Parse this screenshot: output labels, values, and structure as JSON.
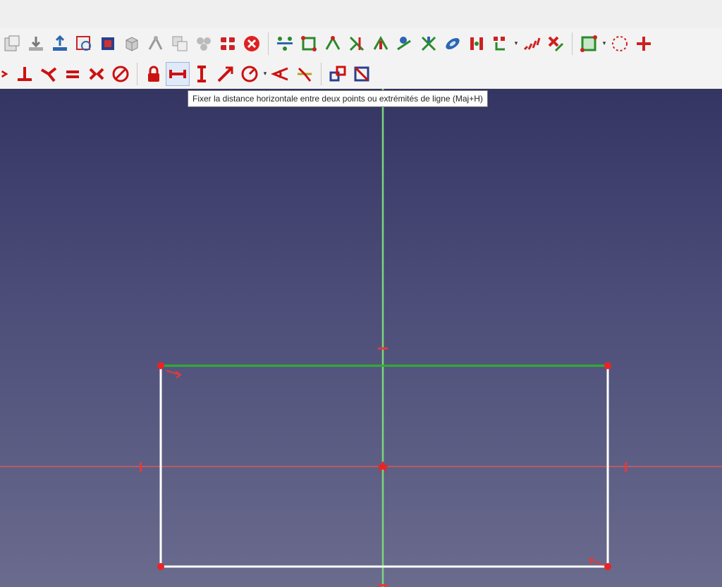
{
  "tooltip": {
    "text": "Fixer la distance horizontale entre deux points ou extrémités de ligne (Maj+H)"
  },
  "toolbar_row1": [
    {
      "name": "part-icon",
      "color": "#8a8a8a"
    },
    {
      "name": "download-icon",
      "color": "#7a7a7a"
    },
    {
      "name": "upload-icon",
      "color": "#2c66b0"
    },
    {
      "name": "view-section-icon",
      "color": "#cc2222"
    },
    {
      "name": "sketch-view-icon",
      "color": "#2a3f8c"
    },
    {
      "name": "cube-icon",
      "color": "#9a9a9a"
    },
    {
      "name": "constraint-tools-icon",
      "color": "#9a9a9a"
    },
    {
      "name": "merge-sketch-icon",
      "color": "#9a9a9a"
    },
    {
      "name": "mirror-sketch-icon",
      "color": "#9a9a9a"
    },
    {
      "name": "validate-sketch-icon",
      "color": "#cc2222"
    },
    {
      "name": "close-sketch-icon",
      "color": "#e02020"
    },
    {
      "name": "select-constraints-icon",
      "color": "#2b8a2b"
    },
    {
      "name": "select-origin-icon",
      "color": "#2b8a2b"
    },
    {
      "name": "select-axis-icon",
      "color": "#2b8a2b"
    },
    {
      "name": "select-redundant-icon",
      "color": "#2b8a2b"
    },
    {
      "name": "select-conflicting-icon",
      "color": "#2b8a2b"
    },
    {
      "name": "select-malformed-icon",
      "color": "#2b8a2b"
    },
    {
      "name": "select-partial-icon",
      "color": "#2b8a2b"
    },
    {
      "name": "show-hide-geometry-icon",
      "color": "#2c66b0"
    },
    {
      "name": "symmetry-icon",
      "color": "#cc2222"
    },
    {
      "name": "clone-icon",
      "color": "#cc2222"
    },
    {
      "name": "rectangular-array-icon",
      "color": "#cc2222"
    },
    {
      "name": "delete-geometry-icon",
      "color": "#cc2222"
    },
    {
      "name": "toggle-construction-icon",
      "color": "#2b8a2b"
    },
    {
      "name": "bspline-tools-icon",
      "color": "#cc2222"
    },
    {
      "name": "pattern-tool-icon",
      "color": "#cc2222"
    }
  ],
  "toolbar_row2": [
    {
      "name": "coincident-constraint-icon",
      "color": "#cc1111"
    },
    {
      "name": "perpendicular-constraint-icon",
      "color": "#cc1111"
    },
    {
      "name": "tangent-constraint-icon",
      "color": "#cc1111"
    },
    {
      "name": "equal-constraint-icon",
      "color": "#cc1111"
    },
    {
      "name": "symmetric-constraint-icon",
      "color": "#cc1111"
    },
    {
      "name": "block-constraint-icon",
      "color": "#cc1111"
    },
    {
      "name": "lock-constraint-icon",
      "color": "#cc1111"
    },
    {
      "name": "horizontal-distance-constraint-icon",
      "color": "#cc1111",
      "active": true
    },
    {
      "name": "vertical-distance-constraint-icon",
      "color": "#cc1111"
    },
    {
      "name": "distance-constraint-icon",
      "color": "#cc1111"
    },
    {
      "name": "radius-constraint-icon",
      "color": "#cc1111"
    },
    {
      "name": "angle-constraint-icon",
      "color": "#cc1111"
    },
    {
      "name": "snell-constraint-icon",
      "color": "#cc1111"
    },
    {
      "name": "internal-alignment-icon",
      "color": "#cc1111"
    },
    {
      "name": "toggle-driving-icon",
      "color": "#2a3f8c"
    }
  ],
  "colors": {
    "sketch_edge": "#ffffff",
    "constrained_edge": "#2fb02f",
    "v_axis": "#7cd67c",
    "h_axis": "#d65a5a",
    "vertex": "#ee2222"
  }
}
